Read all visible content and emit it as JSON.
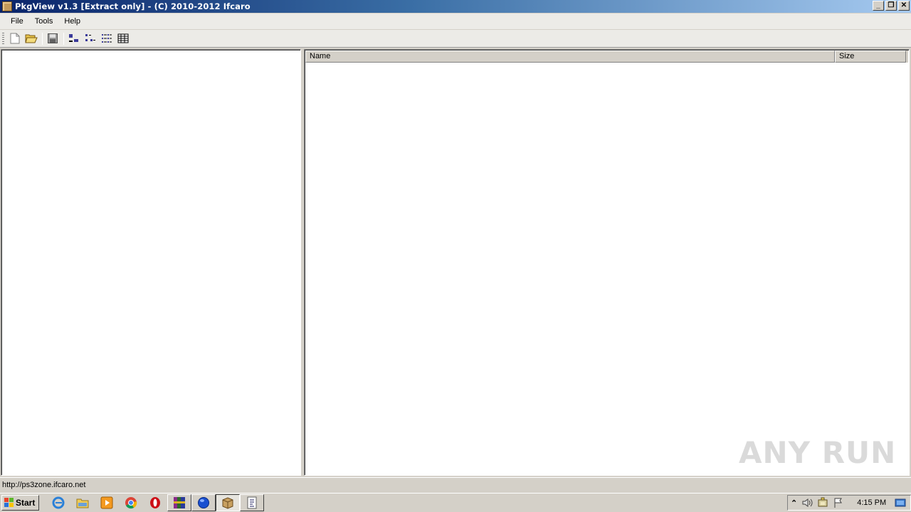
{
  "window": {
    "title": "PkgView v1.3 [Extract only] - (C) 2010-2012 Ifcaro",
    "minimize_label": "_",
    "restore_label": "❐",
    "close_label": "✕"
  },
  "menu": {
    "items": [
      {
        "label": "File"
      },
      {
        "label": "Tools"
      },
      {
        "label": "Help"
      }
    ]
  },
  "toolbar": {
    "buttons": [
      "new-icon",
      "open-folder-icon",
      "save-icon",
      "large-icons-view-icon",
      "small-icons-view-icon",
      "list-view-icon",
      "details-view-icon"
    ]
  },
  "file_list": {
    "columns": [
      {
        "label": "Name"
      },
      {
        "label": "Size"
      }
    ],
    "rows": []
  },
  "status": {
    "text": "http://ps3zone.ifcaro.net"
  },
  "taskbar": {
    "start_label": "Start",
    "clock": "4:15 PM",
    "quick_launch": [
      "internet-explorer-icon",
      "explorer-icon",
      "media-player-icon",
      "chrome-icon",
      "opera-icon",
      "winrar-icon",
      "blue-orb-icon",
      "pkgview-icon",
      "script-icon"
    ]
  },
  "watermark": "ANY RUN"
}
